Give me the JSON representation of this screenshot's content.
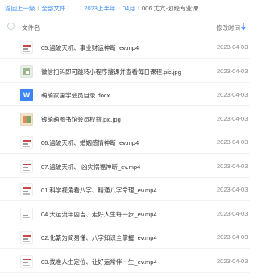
{
  "breadcrumb": {
    "back": "返回上一级",
    "all_files": "全部文件",
    "ellipsis": "...",
    "year": "2023上半年",
    "month": "04月",
    "current": "006.尤亢-划经专业课"
  },
  "header": {
    "col_name": "文件名",
    "col_time": "修改时间"
  },
  "files": [
    {
      "name": "05.遍破天机、事业财运神断_ev.mp4",
      "date": "2023-04-03",
      "type": "video"
    },
    {
      "name": "微信扫码即可跳转小程序搜课并查看每日课程.pic.jpg",
      "date": "2023-04-03",
      "type": "image-qr"
    },
    {
      "name": "萌萌家国学会员目录.docx",
      "date": "2023-04-03",
      "type": "docx"
    },
    {
      "name": "钱萌萌图书馆会员权益.pic.jpg",
      "date": "2023-04-03",
      "type": "image-lib"
    },
    {
      "name": "06.遍破天机、婚姻感情神断_ev.mp4",
      "date": "2023-04-03",
      "type": "video"
    },
    {
      "name": "07.遍破天机、 凶灾祸福神断_ev.mp4",
      "date": "2023-04-03",
      "type": "video"
    },
    {
      "name": "01.科学视角看八字、精通八字命理_ev.mp4",
      "date": "2023-04-03",
      "type": "video"
    },
    {
      "name": "04.大运流年凶吉、走好人生每一步_ev.mp4",
      "date": "2023-04-03",
      "type": "video"
    },
    {
      "name": "02.化繁为简易懂、八字知识全掌握_ev.mp4",
      "date": "2023-04-03",
      "type": "video"
    },
    {
      "name": "03.找准人生定位、让好运常伴一生_ev.mp4",
      "date": "2023-04-03",
      "type": "video"
    }
  ],
  "colors": {
    "link": "#3b8cf5",
    "docx_icon": "#3d85f5",
    "sort_icon": "#3b8cf5"
  }
}
